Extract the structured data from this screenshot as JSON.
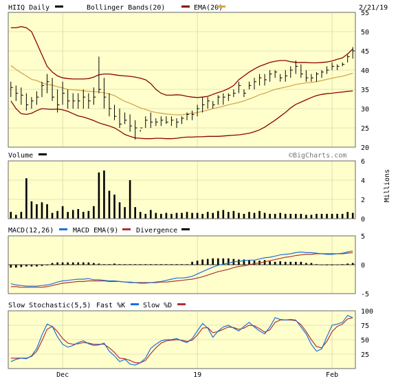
{
  "header": {
    "symbol_label": "HIIQ Daily",
    "bollinger_label": "Bollinger Bands(20)",
    "ema_label": "EMA(20)",
    "date_label": "2/21/19"
  },
  "colors": {
    "background": "#ffffcc",
    "price_bar": "#000000",
    "bollinger": "#8b0000",
    "ema": "#d4a64a",
    "volume": "#000000",
    "macd": "#1e6fd9",
    "macd_ema": "#b03030",
    "fast_k": "#1e6fd9",
    "slow_d": "#b03030",
    "gridline": "#c8c8a0"
  },
  "watermark": "©BigCharts.com",
  "x_axis": {
    "ticks": [
      {
        "label": "Dec",
        "index": 10
      },
      {
        "label": "19",
        "index": 36
      },
      {
        "label": "Feb",
        "index": 62
      }
    ]
  },
  "chart_data": [
    {
      "type": "line",
      "panel": "price",
      "title": "HIIQ Daily",
      "ylim": [
        20,
        55
      ],
      "yticks": [
        20,
        25,
        30,
        35,
        40,
        45,
        50,
        55
      ],
      "grid": true,
      "series": [
        {
          "name": "HIIQ Daily",
          "style": "ohlc",
          "high": [
            37,
            36,
            35.5,
            34,
            33,
            34.5,
            37,
            39,
            38,
            35,
            37,
            35,
            34,
            34,
            35,
            34,
            35.5,
            43.5,
            38,
            34,
            31,
            30,
            29,
            28.5,
            27,
            24.5,
            28,
            29,
            27.5,
            28,
            28,
            28,
            27.5,
            28,
            29,
            29.5,
            31,
            33,
            33,
            32,
            33.5,
            34,
            34,
            35,
            37,
            35,
            37,
            38,
            39,
            39,
            40,
            40,
            39,
            40,
            41,
            42.5,
            41.5,
            40,
            39,
            39.5,
            40,
            41,
            42,
            41.5,
            42,
            44,
            46
          ],
          "low": [
            33,
            32,
            31,
            29.5,
            30,
            31,
            33,
            34,
            32,
            29,
            31,
            30,
            30,
            30,
            30,
            30,
            31,
            34,
            30,
            28,
            27,
            25,
            26,
            24,
            22,
            24,
            25,
            25,
            25.5,
            25.5,
            26,
            25.5,
            25,
            26,
            27,
            27,
            28,
            29,
            30,
            30,
            31,
            31,
            32,
            33,
            34,
            33,
            35,
            35,
            36,
            36,
            37,
            38,
            37,
            37,
            38,
            39,
            38,
            37,
            37,
            37,
            38,
            39,
            40,
            40,
            41,
            42,
            43
          ],
          "close": [
            35.5,
            34,
            33.5,
            31,
            32,
            33,
            36,
            37,
            33,
            31,
            34,
            32,
            32,
            32,
            33,
            32,
            33,
            35,
            33,
            30,
            28,
            26,
            27,
            25.5,
            25,
            25,
            27,
            26.5,
            26.5,
            27,
            26.5,
            27,
            26.5,
            27.5,
            28.5,
            28.5,
            30,
            31,
            32,
            31,
            33,
            33,
            33.5,
            34,
            36,
            34,
            36,
            37,
            38,
            37.5,
            39,
            39.5,
            38,
            38.5,
            40,
            41,
            39,
            38,
            38,
            39,
            39.5,
            40,
            41,
            41,
            41.5,
            43.5,
            45
          ]
        },
        {
          "name": "Bollinger Bands(20)",
          "role": "upper",
          "values": [
            51,
            51,
            51.3,
            51,
            50,
            47,
            44,
            41,
            39.5,
            38.5,
            38,
            37.8,
            37.7,
            37.7,
            37.7,
            37.8,
            38.2,
            38.8,
            39,
            39,
            38.8,
            38.6,
            38.5,
            38.4,
            38.2,
            37.9,
            37.5,
            36.5,
            35,
            34,
            33.5,
            33.5,
            33.6,
            33.5,
            33.2,
            33,
            32.9,
            33,
            33.2,
            33.7,
            34.2,
            34.6,
            35.2,
            36,
            37.5,
            38.5,
            39.5,
            40.3,
            41,
            41.5,
            42,
            42.3,
            42.5,
            42.5,
            42.2,
            42,
            42,
            42,
            41.9,
            41.9,
            42,
            42.1,
            42.4,
            42.8,
            43.2,
            44.2,
            45.5
          ]
        },
        {
          "name": "Bollinger Bands(20)",
          "role": "lower",
          "values": [
            32,
            30,
            28.7,
            28.5,
            28.8,
            29.5,
            30,
            29.9,
            29.8,
            29.9,
            29.7,
            29.3,
            28.7,
            28.1,
            27.8,
            27.4,
            26.9,
            26.3,
            25.9,
            25.5,
            25,
            24.2,
            23.3,
            22.8,
            22.4,
            22.3,
            22.2,
            22.2,
            22.3,
            22.3,
            22.2,
            22.2,
            22.3,
            22.5,
            22.6,
            22.6,
            22.7,
            22.7,
            22.8,
            22.8,
            22.8,
            22.9,
            23,
            23.1,
            23.2,
            23.4,
            23.6,
            24,
            24.5,
            25.2,
            26.1,
            27,
            28,
            29,
            30.2,
            31.1,
            31.7,
            32.3,
            32.9,
            33.4,
            33.7,
            33.9,
            34,
            34.2,
            34.3,
            34.5,
            34.6
          ]
        },
        {
          "name": "EMA(20)",
          "values": [
            41.2,
            40.2,
            39.3,
            38.5,
            37.6,
            37.3,
            36.7,
            36.3,
            36.1,
            35.7,
            35.4,
            35,
            34.9,
            34.8,
            34.6,
            34.5,
            34.4,
            34.3,
            34.1,
            33.8,
            33.4,
            32.6,
            31.9,
            31.4,
            30.8,
            30.2,
            29.8,
            29.3,
            29,
            28.8,
            28.6,
            28.5,
            28.4,
            28.4,
            28.6,
            28.8,
            29,
            29.3,
            29.6,
            30,
            30.3,
            30.6,
            31,
            31.3,
            31.6,
            32,
            32.5,
            33,
            33.6,
            34,
            34.5,
            35,
            35.3,
            35.6,
            35.9,
            36.3,
            36.5,
            36.7,
            36.8,
            37,
            37.3,
            37.6,
            37.9,
            38.2,
            38.4,
            38.8,
            39.2
          ]
        }
      ]
    },
    {
      "type": "bar",
      "panel": "volume",
      "title": "Volume",
      "ylabel": "Millions",
      "ylim": [
        0,
        6
      ],
      "yticks": [
        0,
        2,
        4,
        6
      ],
      "series": [
        {
          "name": "Volume",
          "values": [
            0.7,
            0.4,
            0.7,
            4.2,
            1.8,
            1.5,
            1.7,
            1.5,
            0.6,
            0.8,
            1.3,
            0.7,
            0.9,
            1,
            0.7,
            0.8,
            1.3,
            4.8,
            5,
            2.9,
            2.5,
            1.7,
            1.2,
            4,
            1.2,
            0.7,
            0.5,
            0.9,
            0.6,
            0.5,
            0.6,
            0.5,
            0.6,
            0.6,
            0.7,
            0.6,
            0.6,
            0.5,
            0.7,
            0.6,
            0.8,
            0.9,
            0.7,
            0.8,
            0.6,
            0.5,
            0.7,
            0.6,
            0.8,
            0.6,
            0.5,
            0.5,
            0.6,
            0.5,
            0.5,
            0.5,
            0.5,
            0.4,
            0.4,
            0.5,
            0.5,
            0.5,
            0.5,
            0.5,
            0.5,
            0.7,
            0.6
          ]
        }
      ]
    },
    {
      "type": "line",
      "panel": "macd",
      "title": "MACD(12,26)",
      "ylim": [
        -5,
        5
      ],
      "yticks": [
        -5,
        0,
        5
      ],
      "series": [
        {
          "name": "MACD(12,26)",
          "values": [
            -3.3,
            -3.5,
            -3.6,
            -3.7,
            -3.7,
            -3.7,
            -3.6,
            -3.5,
            -3.3,
            -3,
            -2.8,
            -2.7,
            -2.6,
            -2.5,
            -2.5,
            -2.4,
            -2.6,
            -2.6,
            -2.7,
            -2.8,
            -2.8,
            -2.9,
            -3,
            -3.1,
            -3.1,
            -3.2,
            -3.2,
            -3.1,
            -3,
            -2.9,
            -2.7,
            -2.5,
            -2.3,
            -2.3,
            -2.2,
            -2,
            -1.6,
            -1.2,
            -0.8,
            -0.4,
            -0.1,
            0.1,
            0.3,
            0.5,
            0.6,
            0.7,
            0.8,
            0.8,
            1,
            1.2,
            1.3,
            1.5,
            1.7,
            1.8,
            1.9,
            2.1,
            2.2,
            2.1,
            2.1,
            2,
            1.9,
            1.8,
            1.8,
            1.9,
            2,
            2.2,
            2.4
          ]
        },
        {
          "name": "MACD EMA(9)",
          "values": [
            -3.8,
            -3.8,
            -3.9,
            -3.9,
            -3.9,
            -3.9,
            -3.9,
            -3.8,
            -3.6,
            -3.4,
            -3.2,
            -3.1,
            -3,
            -2.9,
            -2.9,
            -2.8,
            -2.8,
            -2.8,
            -2.8,
            -2.9,
            -2.9,
            -2.9,
            -3,
            -3,
            -3.1,
            -3.1,
            -3.1,
            -3.1,
            -3.1,
            -3,
            -3,
            -2.9,
            -2.8,
            -2.7,
            -2.6,
            -2.5,
            -2.3,
            -2.1,
            -1.8,
            -1.5,
            -1.2,
            -1,
            -0.8,
            -0.5,
            -0.3,
            -0.2,
            0,
            0.2,
            0.3,
            0.5,
            0.7,
            0.9,
            1.1,
            1.3,
            1.4,
            1.6,
            1.7,
            1.8,
            1.8,
            1.9,
            1.9,
            1.9,
            1.9,
            1.9,
            1.9,
            2,
            2.1
          ]
        },
        {
          "name": "Divergence",
          "values": [
            -0.5,
            -0.5,
            -0.4,
            -0.3,
            -0.3,
            -0.3,
            -0.2,
            -0.1,
            0.3,
            0.4,
            0.4,
            0.4,
            0.4,
            0.4,
            0.4,
            0.4,
            0.3,
            0.2,
            0.1,
            0.1,
            0.2,
            0.1,
            0.1,
            0.1,
            0.1,
            0.1,
            0.1,
            0.1,
            0.1,
            0.1,
            0.1,
            0.1,
            0.1,
            0.1,
            0.1,
            0.5,
            0.7,
            0.9,
            1,
            1.1,
            1.1,
            1.1,
            1.1,
            1,
            0.9,
            0.9,
            0.8,
            0.7,
            0.7,
            0.8,
            0.6,
            0.5,
            0.6,
            0.5,
            0.5,
            0.5,
            0.5,
            0.3,
            0.3,
            0.1,
            0,
            -0.1,
            -0.1,
            0,
            0.1,
            0.2,
            0.3
          ]
        }
      ]
    },
    {
      "type": "line",
      "panel": "stochastic",
      "title": "Slow Stochastic(5,5)",
      "ylim": [
        0,
        100
      ],
      "yticks": [
        25,
        50,
        75,
        100
      ],
      "series": [
        {
          "name": "Fast %K",
          "values": [
            12,
            16,
            18,
            17,
            22,
            35,
            58,
            77,
            73,
            55,
            42,
            37,
            40,
            45,
            48,
            43,
            40,
            41,
            44,
            30,
            22,
            12,
            16,
            8,
            6,
            10,
            18,
            35,
            42,
            48,
            50,
            50,
            52,
            48,
            45,
            52,
            65,
            78,
            70,
            54,
            65,
            72,
            75,
            70,
            65,
            73,
            80,
            72,
            65,
            60,
            72,
            88,
            85,
            84,
            85,
            84,
            72,
            60,
            42,
            30,
            34,
            55,
            75,
            77,
            80,
            92,
            88
          ]
        },
        {
          "name": "Slow %D",
          "values": [
            18,
            18,
            18,
            18,
            21,
            30,
            48,
            68,
            73,
            64,
            52,
            44,
            42,
            43,
            45,
            44,
            42,
            42,
            42,
            36,
            28,
            18,
            17,
            14,
            10,
            10,
            14,
            26,
            36,
            44,
            48,
            49,
            50,
            49,
            47,
            49,
            58,
            70,
            71,
            62,
            64,
            68,
            72,
            71,
            68,
            70,
            75,
            74,
            69,
            63,
            67,
            80,
            84,
            84,
            84,
            83,
            76,
            64,
            50,
            38,
            36,
            47,
            64,
            73,
            77,
            86,
            88
          ]
        }
      ]
    }
  ],
  "panels": {
    "price": {
      "ticks": [
        "55",
        "50",
        "45",
        "40",
        "35",
        "30",
        "25",
        "20"
      ]
    },
    "volume": {
      "title": "Volume",
      "ylabel": "Millions",
      "ticks": [
        "6",
        "4",
        "2",
        "0"
      ]
    },
    "macd": {
      "title_macd": "MACD(12,26)",
      "title_ema": "MACD EMA(9)",
      "title_div": "Divergence",
      "ticks": [
        "5",
        "0",
        "-5"
      ]
    },
    "stochastic": {
      "title": "Slow Stochastic(5,5)",
      "fast_label": "Fast %K",
      "slow_label": "Slow %D",
      "ticks": [
        "100",
        "75",
        "50",
        "25"
      ]
    }
  }
}
